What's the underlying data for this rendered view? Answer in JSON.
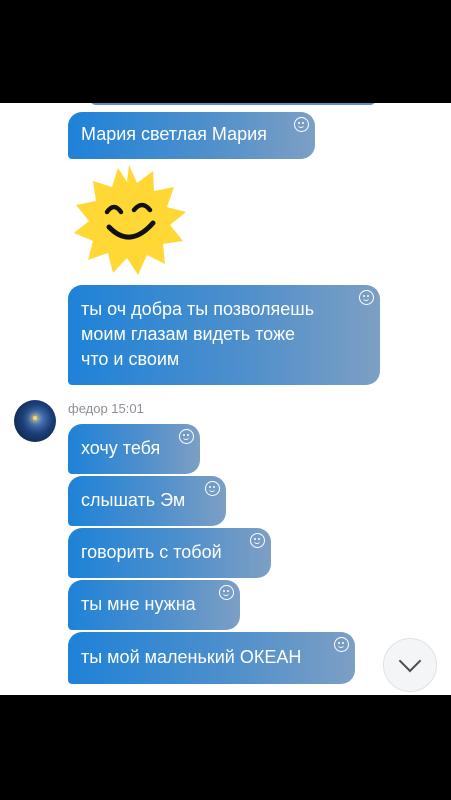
{
  "messages_top": [
    {
      "text": "Мария светлая Мария"
    },
    {
      "sticker": "smiling-sun-sticker"
    },
    {
      "lines": [
        "ты оч добра ты позволяешь",
        "моим глазам видеть тоже",
        "что и своим"
      ]
    }
  ],
  "group": {
    "sender": "федор",
    "time": "15:01",
    "sender_line": "федор 15:01",
    "avatar": "night-sky-avatar",
    "messages": [
      {
        "text": "хочу тебя"
      },
      {
        "text": "слышать Эм"
      },
      {
        "text": "говорить с тобой"
      },
      {
        "text": "ты мне нужна"
      },
      {
        "text": "ты мой маленький ОКЕАН"
      }
    ]
  },
  "icons": {
    "reaction": "smile-reaction-icon",
    "scroll": "chevron-down-icon"
  },
  "colors": {
    "bubble_start": "#1e82d8",
    "bubble_end": "#7d9fc4",
    "sun": "#ffd836",
    "meta_text": "#8a8f96"
  }
}
